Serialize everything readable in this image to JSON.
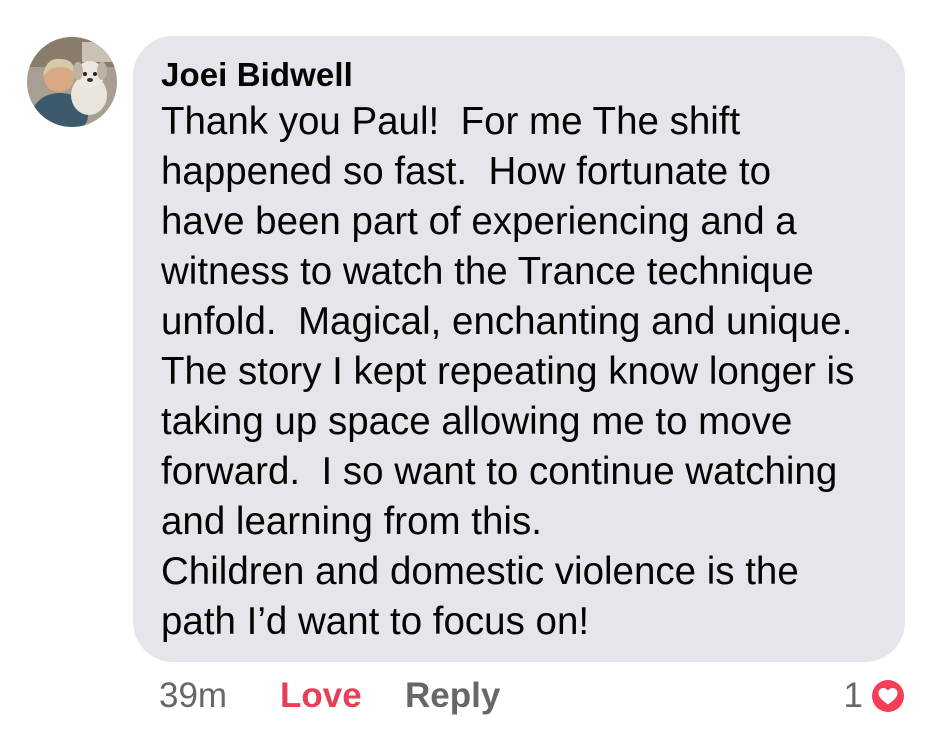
{
  "comment": {
    "author": "Joei Bidwell",
    "lines": [
      "Thank you Paul!  For me The shift",
      "happened so fast.  How fortunate to",
      "have been part of experiencing and a",
      "witness to watch the Trance technique",
      "unfold.  Magical, enchanting and unique.",
      "The story I kept repeating know longer is",
      "taking up space allowing me to move",
      "forward.  I so want to continue watching",
      "and learning from this.",
      "Children and domestic violence is the",
      "path I’d want to focus on!"
    ]
  },
  "actions": {
    "time": "39m",
    "love": "Love",
    "reply": "Reply"
  },
  "reactions": {
    "count": "1",
    "icon": "love-reaction-icon",
    "color": "#f33e58"
  },
  "colors": {
    "bubble": "#e4e6eb",
    "text": "#050505",
    "secondary": "#65676b",
    "love": "#e4405a"
  }
}
